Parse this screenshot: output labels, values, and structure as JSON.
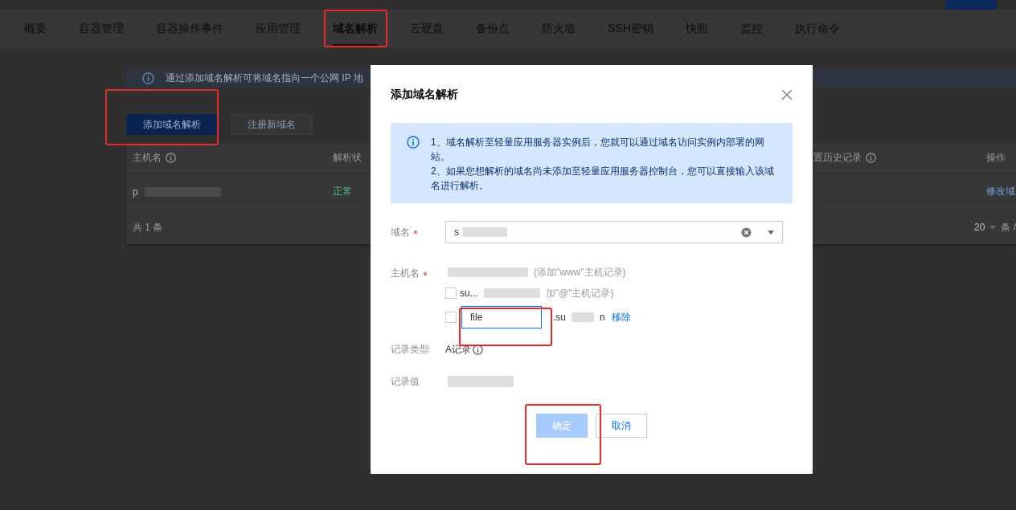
{
  "tabs": [
    {
      "label": "概要",
      "selected": false
    },
    {
      "label": "容器管理",
      "selected": false
    },
    {
      "label": "容器操作事件",
      "selected": false
    },
    {
      "label": "应用管理",
      "selected": false
    },
    {
      "label": "域名解析",
      "selected": true
    },
    {
      "label": "云硬盘",
      "selected": false
    },
    {
      "label": "备份点",
      "selected": false
    },
    {
      "label": "防火墙",
      "selected": false
    },
    {
      "label": "SSH密钥",
      "selected": false
    },
    {
      "label": "快照",
      "selected": false
    },
    {
      "label": "监控",
      "selected": false
    },
    {
      "label": "执行命令",
      "selected": false
    }
  ],
  "notice": "通过添加域名解析可将域名指向一个公网 IP 地",
  "actions": [
    {
      "label": "添加域名解析",
      "kind": "primary"
    },
    {
      "label": "注册新域名",
      "kind": "secondary"
    }
  ],
  "table": {
    "columns": [
      "主机名",
      "解析状",
      "置历史记录",
      "操作"
    ],
    "rows": [
      {
        "host": "p",
        "status": "正常",
        "action": "修改域"
      }
    ],
    "total": "共 1 条",
    "page_size": "20",
    "per_page": "条 /"
  },
  "dialog": {
    "title": "添加域名解析",
    "tips": [
      "1、域名解析至轻量应用服务器实例后，您就可以通过域名访问实例内部署的网站。",
      "2、如果您想解析的域名尚未添加至轻量应用服务器控制台，您可以直接输入该域名进行解析。"
    ],
    "domain": {
      "label": "域名",
      "value": "s"
    },
    "host": {
      "label": "主机名",
      "options": [
        {
          "kind": "preset",
          "note": "(添加\"www\"主机记录)"
        },
        {
          "kind": "preset_checkbox",
          "checked": false,
          "prefix": "su...",
          "note": "加\"@\"主机记录)"
        },
        {
          "kind": "custom",
          "checked": false,
          "value": "file",
          "suffix_start": ".su",
          "suffix_end": "n",
          "remove": "移除"
        }
      ]
    },
    "record_type": {
      "label": "记录类型",
      "value": "A记录"
    },
    "record_value": {
      "label": "记录值"
    },
    "buttons": [
      {
        "label": "确定",
        "kind": "primary",
        "disabled": true
      },
      {
        "label": "取消",
        "kind": "default",
        "disabled": false
      }
    ]
  }
}
